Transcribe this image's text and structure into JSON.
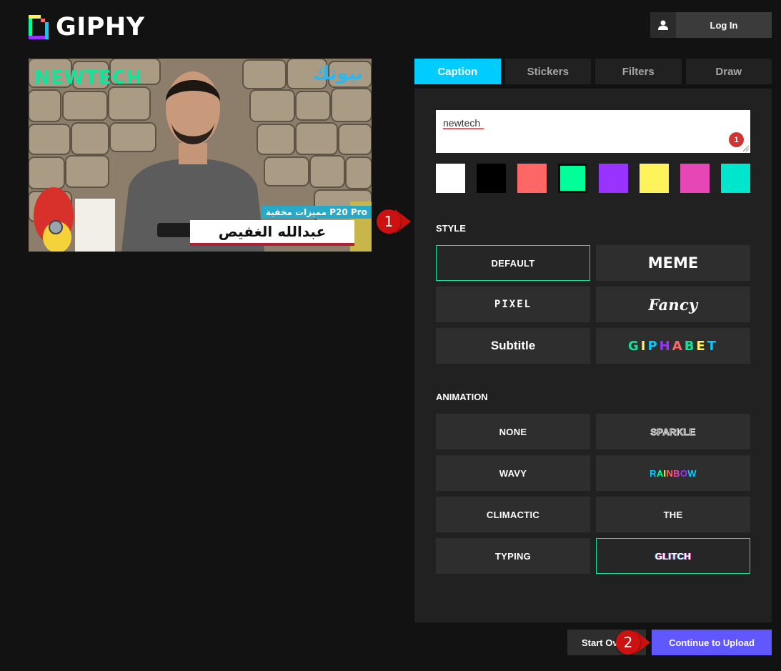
{
  "header": {
    "logo_text": "GIPHY",
    "login_label": "Log In"
  },
  "preview": {
    "brand_en": "NEWTECH",
    "brand_ar": "نيوتك",
    "subtitle_ar": "مميزات مخفية P20 Pro",
    "name_ar": "عبدالله الغفيص"
  },
  "tabs": [
    {
      "label": "Caption",
      "active": true
    },
    {
      "label": "Stickers",
      "active": false
    },
    {
      "label": "Filters",
      "active": false
    },
    {
      "label": "Draw",
      "active": false
    }
  ],
  "caption": {
    "value": "newtech",
    "badge_count": "1"
  },
  "colors": [
    "#ffffff",
    "#000000",
    "#ff6666",
    "#00ff99",
    "#9933ff",
    "#fff35c",
    "#e646b6",
    "#00e6cc"
  ],
  "selected_color": "#00ff99",
  "style": {
    "title": "STYLE",
    "options": [
      "DEFAULT",
      "MEME",
      "PIXEL",
      "Fancy",
      "Subtitle",
      "GIPHABET"
    ],
    "selected": "DEFAULT"
  },
  "animation": {
    "title": "ANIMATION",
    "options": [
      "NONE",
      "SPARKLE",
      "WAVY",
      "RAINBOW",
      "CLIMACTIC",
      "THE",
      "TYPING",
      "GLITCH"
    ],
    "selected": "GLITCH"
  },
  "footer": {
    "start_over_label": "Start Over",
    "continue_label": "Continue to Upload"
  },
  "markers": [
    "1",
    "2"
  ],
  "accent_colors": {
    "caption_tab": "#00ccff",
    "selected_border": "#10e29a",
    "continue_button": "#6157ff",
    "marker": "#cc1111"
  }
}
